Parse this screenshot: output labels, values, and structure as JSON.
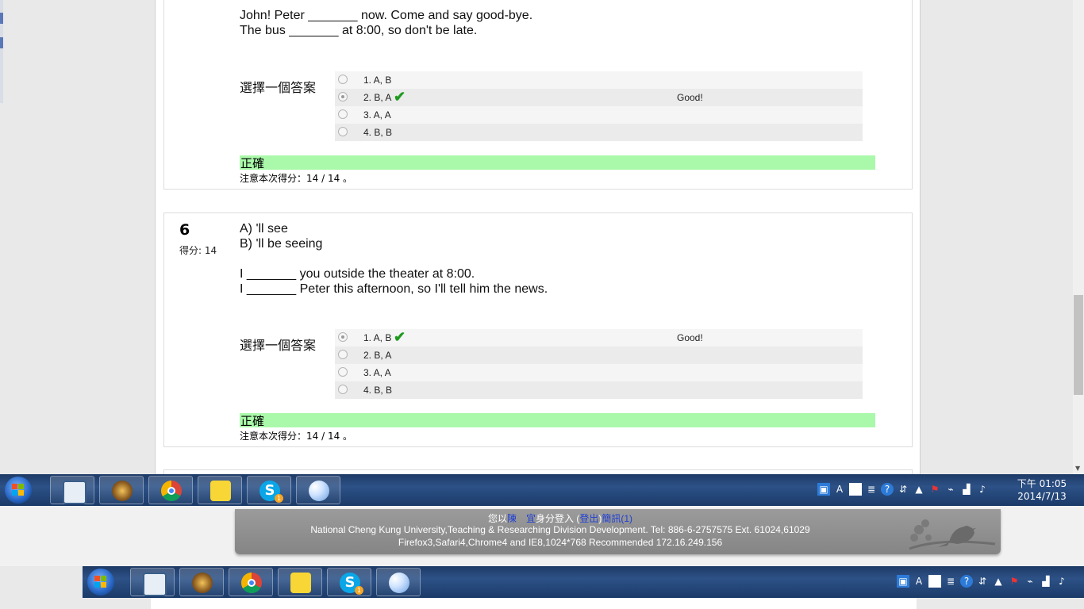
{
  "questions": [
    {
      "lines": [
        "John! Peter _______ now. Come and say good-bye.",
        "The bus _______ at 8:00, so don't be late."
      ],
      "select_label": "選擇一個答案",
      "answers": [
        {
          "label": "1. A, B",
          "selected": false,
          "correct": false,
          "feedback": ""
        },
        {
          "label": "2. B, A",
          "selected": true,
          "correct": true,
          "feedback": "Good!"
        },
        {
          "label": "3. A, A",
          "selected": false,
          "correct": false,
          "feedback": ""
        },
        {
          "label": "4. B, B",
          "selected": false,
          "correct": false,
          "feedback": ""
        }
      ],
      "result": "正確",
      "grade_note": "注意本次得分：14 / 14 。"
    },
    {
      "number": "6",
      "score_label": "得分: 14",
      "lines": [
        "A) 'll see",
        "B) 'll be seeing",
        "",
        "I _______ you outside the theater at 8:00.",
        "I _______ Peter this afternoon, so I'll tell him the news."
      ],
      "select_label": "選擇一個答案",
      "answers": [
        {
          "label": "1. A, B",
          "selected": true,
          "correct": true,
          "feedback": "Good!"
        },
        {
          "label": "2. B, A",
          "selected": false,
          "correct": false,
          "feedback": ""
        },
        {
          "label": "3. A, A",
          "selected": false,
          "correct": false,
          "feedback": ""
        },
        {
          "label": "4. B, B",
          "selected": false,
          "correct": false,
          "feedback": ""
        }
      ],
      "result": "正確",
      "grade_note": "注意本次得分：14 / 14 。"
    }
  ],
  "footer": {
    "login_prefix": "您以",
    "user_name": "陳　宜",
    "login_mid": "身分登入 (",
    "logout": "登出",
    "login_close": ")",
    "messages": "簡訊(1)",
    "line2": "National Cheng Kung University,Teaching & Researching Division Development. Tel: 886-6-2757575 Ext. 61024,61029",
    "line3": "Firefox3,Safari4,Chrome4 and IE8,1024*768 Recommended 172.16.249.156"
  },
  "taskbar": {
    "apps": [
      "file-manager-icon",
      "hearthstone-icon",
      "chrome-icon",
      "kakao-icon",
      "skype-icon",
      "paint-icon"
    ],
    "skype_badge": "1",
    "clock_time": "下午 01:05",
    "clock_date": "2014/7/13"
  },
  "colors": {
    "correct_bar": "#aaf9aa",
    "check": "#1f9a1f",
    "taskbar": "#1d3a66",
    "footer_bg": "#909090",
    "link": "#1f3fd4"
  }
}
